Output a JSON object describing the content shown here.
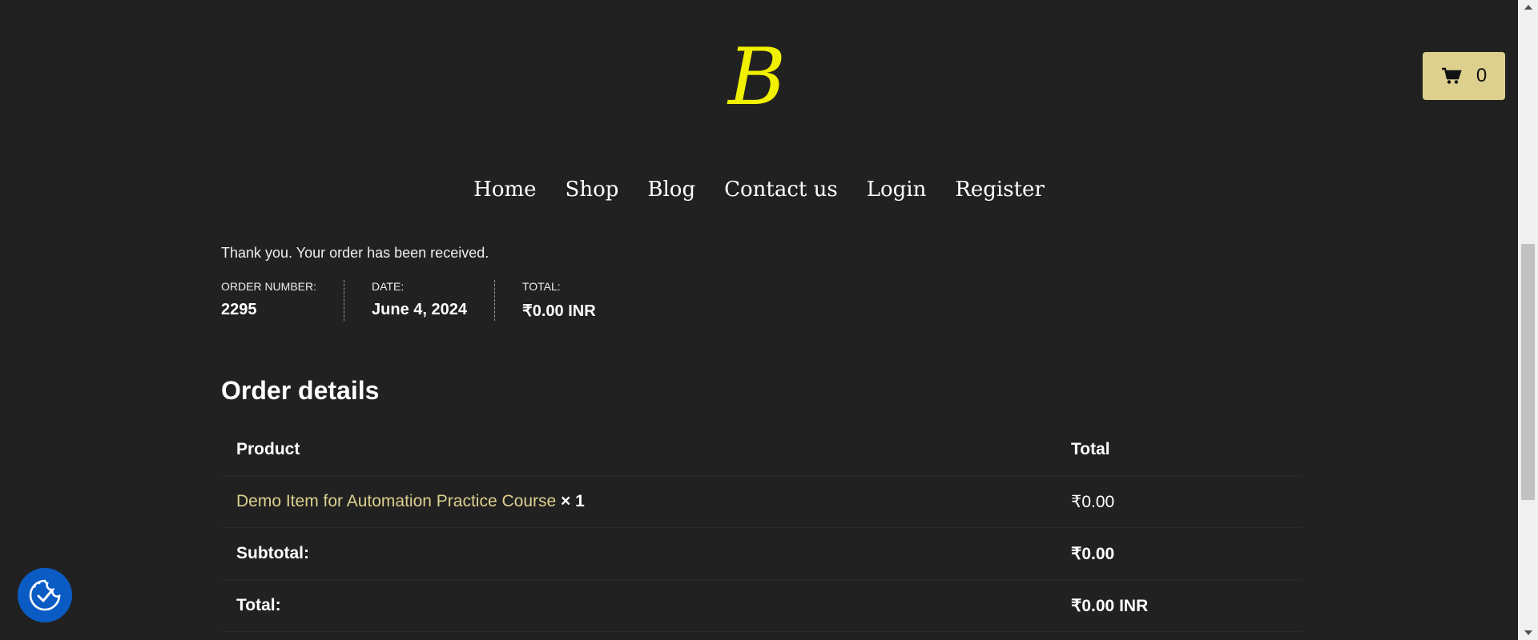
{
  "header": {
    "logo_letter": "B",
    "logo_color": "#f0f000",
    "cart": {
      "count": "0",
      "icon": "cart-icon",
      "bg": "#ddd08f"
    }
  },
  "nav": {
    "items": [
      "Home",
      "Shop",
      "Blog",
      "Contact us",
      "Login",
      "Register"
    ]
  },
  "order": {
    "thanks": "Thank you. Your order has been received.",
    "overview": [
      {
        "label": "Order number:",
        "value": "2295"
      },
      {
        "label": "Date:",
        "value": "June 4, 2024"
      },
      {
        "label": "Total:",
        "value": "₹0.00 INR"
      }
    ],
    "details_title": "Order details",
    "table": {
      "headers": {
        "product": "Product",
        "total": "Total"
      },
      "item": {
        "name": "Demo Item for Automation Practice Course",
        "qty": "× 1",
        "total": "₹0.00"
      },
      "subtotal": {
        "label": "Subtotal:",
        "value": "₹0.00"
      },
      "total": {
        "label": "Total:",
        "value": "₹0.00 INR"
      }
    }
  },
  "cookie_button": {
    "icon": "cookie-consent-icon",
    "color": "#0a5cc4"
  },
  "colors": {
    "background": "#212121",
    "accent": "#ddd08f"
  }
}
